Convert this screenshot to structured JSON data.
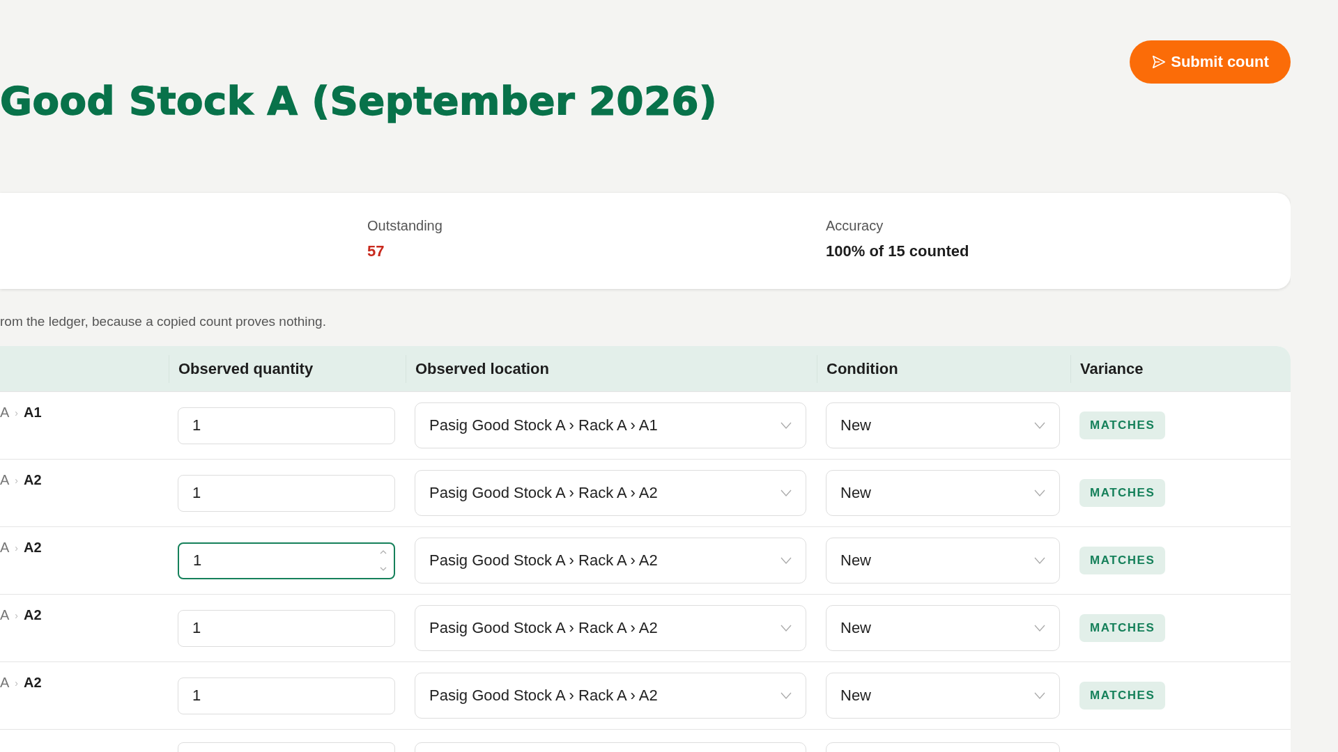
{
  "title": "Good Stock A (September 2026)",
  "submit_button": {
    "label": "Submit count"
  },
  "stats": [
    {
      "label": "Outstanding",
      "value": "57",
      "kind": "alert"
    },
    {
      "label": "Accuracy",
      "value": "100% of 15 counted",
      "kind": "plain"
    }
  ],
  "note": "rom the ledger, because a copied count proves nothing.",
  "table": {
    "columns": [
      "",
      "Observed quantity",
      "Observed location",
      "Condition",
      "Variance"
    ],
    "rows": [
      {
        "area": "A",
        "sep": "›",
        "bin": "A1",
        "quantity": "1",
        "focused": false,
        "location": "Pasig Good Stock A › Rack A › A1",
        "condition": "New",
        "variance": "MATCHES"
      },
      {
        "area": "A",
        "sep": "›",
        "bin": "A2",
        "quantity": "1",
        "focused": false,
        "location": "Pasig Good Stock A › Rack A › A2",
        "condition": "New",
        "variance": "MATCHES"
      },
      {
        "area": "A",
        "sep": "›",
        "bin": "A2",
        "quantity": "1",
        "focused": true,
        "location": "Pasig Good Stock A › Rack A › A2",
        "condition": "New",
        "variance": "MATCHES"
      },
      {
        "area": "A",
        "sep": "›",
        "bin": "A2",
        "quantity": "1",
        "focused": false,
        "location": "Pasig Good Stock A › Rack A › A2",
        "condition": "New",
        "variance": "MATCHES"
      },
      {
        "area": "A",
        "sep": "›",
        "bin": "A2",
        "quantity": "1",
        "focused": false,
        "location": "Pasig Good Stock A › Rack A › A2",
        "condition": "New",
        "variance": "MATCHES"
      }
    ]
  }
}
